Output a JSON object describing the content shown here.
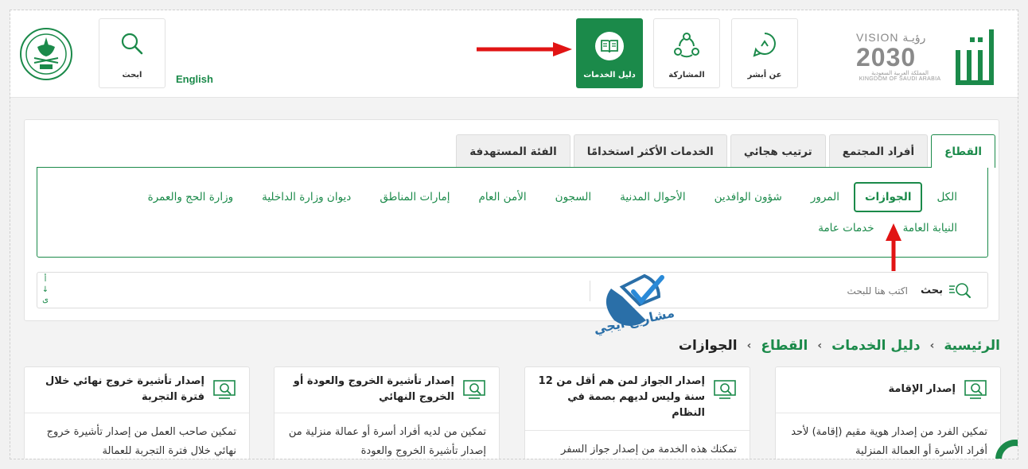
{
  "header": {
    "brand_colors": {
      "green": "#1b8a4a",
      "grey": "#8a8a8a"
    },
    "vision": {
      "top": "VISION رؤيـة",
      "year": "2030",
      "ar": "المملكة العربية السعودية",
      "en": "KINGDOM OF SAUDI ARABIA"
    },
    "nav": {
      "about": "عن أبشر",
      "participation": "المشاركة",
      "services_guide": "دليل الخدمات",
      "search": "ابحث"
    },
    "english": "English"
  },
  "tabs": [
    {
      "label": "القطاع",
      "active": true
    },
    {
      "label": "أفراد المجتمع",
      "active": false
    },
    {
      "label": "ترتيب هجائي",
      "active": false
    },
    {
      "label": "الخدمات الأكثر استخدامًا",
      "active": false
    },
    {
      "label": "الفئة المستهدفة",
      "active": false
    }
  ],
  "categories_row1": [
    {
      "label": "الكل",
      "active": false
    },
    {
      "label": "الجوازات",
      "active": true
    },
    {
      "label": "المرور",
      "active": false
    },
    {
      "label": "شؤون الوافدين",
      "active": false
    },
    {
      "label": "الأحوال المدنية",
      "active": false
    },
    {
      "label": "السجون",
      "active": false
    },
    {
      "label": "الأمن العام",
      "active": false
    },
    {
      "label": "إمارات المناطق",
      "active": false
    },
    {
      "label": "ديوان وزارة الداخلية",
      "active": false
    },
    {
      "label": "وزارة الحج والعمرة",
      "active": false
    }
  ],
  "categories_row2": [
    {
      "label": "النيابة العامة",
      "active": false
    },
    {
      "label": "خدمات عامة",
      "active": false
    }
  ],
  "search": {
    "label": "بحث",
    "placeholder": "اكتب هنا للبحث",
    "alpha_top": "أ",
    "alpha_arrow": "↓",
    "alpha_bottom": "ى"
  },
  "watermark": {
    "text": "مشاريع ايجي"
  },
  "breadcrumb": {
    "home": "الرئيسية",
    "guide": "دليل الخدمات",
    "sector": "القطاع",
    "current": "الجوازات"
  },
  "cards": [
    {
      "title": "إصدار الإقامة",
      "desc": "تمكين الفرد من إصدار هوية مقيم (إقامة) لأحد أفراد الأسرة أو العمالة المنزلية"
    },
    {
      "title": "إصدار الجواز لمن هم أقل من 12 سنة وليس لديهم بصمة في النظام",
      "desc": "تمكنك هذه الخدمة من إصدار جواز السفر"
    },
    {
      "title": "إصدار تأشيرة الخروج والعودة أو الخروج النهائي",
      "desc": "تمكين من لديه أفراد أسرة أو عمالة منزلية من إصدار تأشيرة الخروج والعودة"
    },
    {
      "title": "إصدار تأشيرة خروج نهائي خلال فترة التجربة",
      "desc": "تمكين صاحب العمل من إصدار تأشيرة خروج نهائي خلال فترة التجربة للعمالة"
    }
  ]
}
